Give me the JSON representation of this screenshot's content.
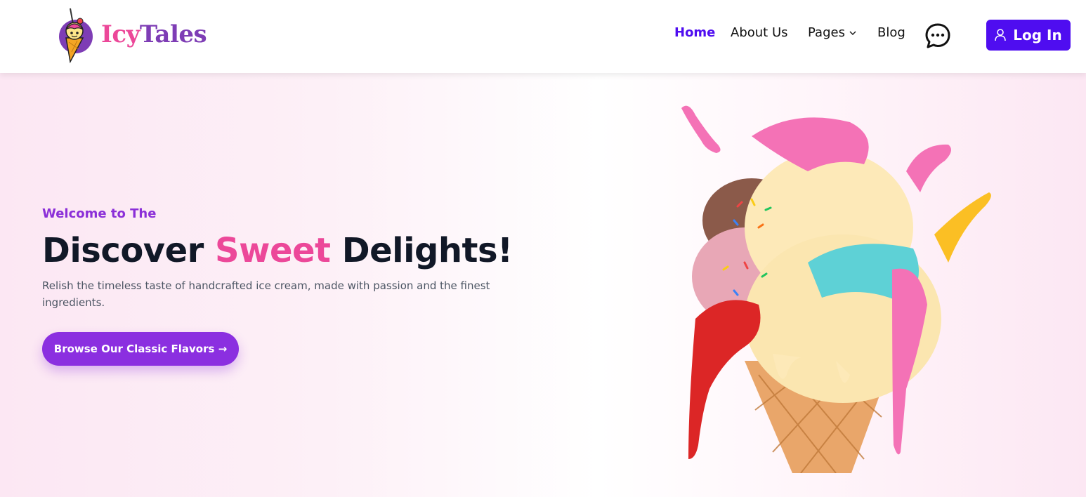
{
  "brand": {
    "name_part1": "Icy",
    "name_part2": "Tales",
    "logo_icon": "ice-cream-cone-logo"
  },
  "nav": {
    "items": [
      {
        "label": "Home",
        "active": true
      },
      {
        "label": "About Us",
        "active": false
      },
      {
        "label": "Pages",
        "active": false,
        "has_dropdown": true
      },
      {
        "label": "Blog",
        "active": false
      }
    ],
    "chat_icon": "chat-bubble-icon",
    "login_label": "Log In",
    "login_icon": "user-icon"
  },
  "hero": {
    "eyebrow": "Welcome to The",
    "headline_part1": "Discover",
    "headline_highlight": "Sweet",
    "headline_part2": "Delights!",
    "subtext": "Relish the timeless taste of handcrafted ice cream, made with passion and the finest ingredients.",
    "cta_label": "Browse Our Classic Flavors →",
    "image": "ice-cream-cone-illustration"
  },
  "colors": {
    "brand_primary": "#4f0df0",
    "accent_pink": "#ec4899",
    "accent_purple": "#8b2fe0",
    "hero_bg": "#fce7f3"
  }
}
